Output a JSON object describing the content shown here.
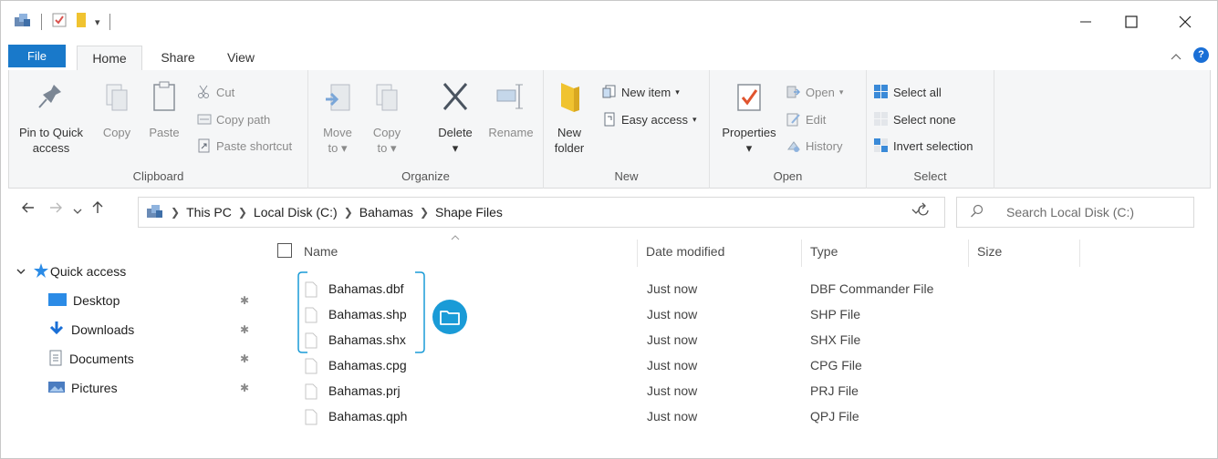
{
  "tabs": {
    "file": "File",
    "home": "Home",
    "share": "Share",
    "view": "View"
  },
  "ribbon": {
    "clipboard": {
      "label": "Clipboard",
      "pin_line1": "Pin to Quick",
      "pin_line2": "access",
      "copy": "Copy",
      "paste": "Paste",
      "cut": "Cut",
      "copy_path": "Copy path",
      "paste_shortcut": "Paste shortcut"
    },
    "organize": {
      "label": "Organize",
      "move_line1": "Move",
      "move_line2": "to",
      "copy_line1": "Copy",
      "copy_line2": "to",
      "delete": "Delete",
      "rename": "Rename"
    },
    "new": {
      "label": "New",
      "folder_line1": "New",
      "folder_line2": "folder",
      "new_item": "New item",
      "easy_access": "Easy access"
    },
    "open": {
      "label": "Open",
      "properties": "Properties",
      "open": "Open",
      "edit": "Edit",
      "history": "History"
    },
    "select": {
      "label": "Select",
      "select_all": "Select all",
      "select_none": "Select none",
      "invert": "Invert selection"
    }
  },
  "address": {
    "crumbs": [
      "This PC",
      "Local Disk (C:)",
      "Bahamas",
      "Shape Files"
    ],
    "search_placeholder": "Search Local Disk (C:)"
  },
  "navpane": {
    "quick_access": "Quick access",
    "items": [
      "Desktop",
      "Downloads",
      "Documents",
      "Pictures"
    ]
  },
  "columns": {
    "name": "Name",
    "date": "Date modified",
    "type": "Type",
    "size": "Size"
  },
  "files": [
    {
      "name": "Bahamas.dbf",
      "date": "Just now",
      "type": "DBF Commander File"
    },
    {
      "name": "Bahamas.shp",
      "date": "Just now",
      "type": "SHP File"
    },
    {
      "name": "Bahamas.shx",
      "date": "Just now",
      "type": "SHX File"
    },
    {
      "name": "Bahamas.cpg",
      "date": "Just now",
      "type": "CPG File"
    },
    {
      "name": "Bahamas.prj",
      "date": "Just now",
      "type": "PRJ File"
    },
    {
      "name": "Bahamas.qph",
      "date": "Just now",
      "type": "QPJ File"
    }
  ],
  "colors": {
    "accent": "#1979ca",
    "callout": "#1a9bd7",
    "folder": "#f0c330"
  }
}
